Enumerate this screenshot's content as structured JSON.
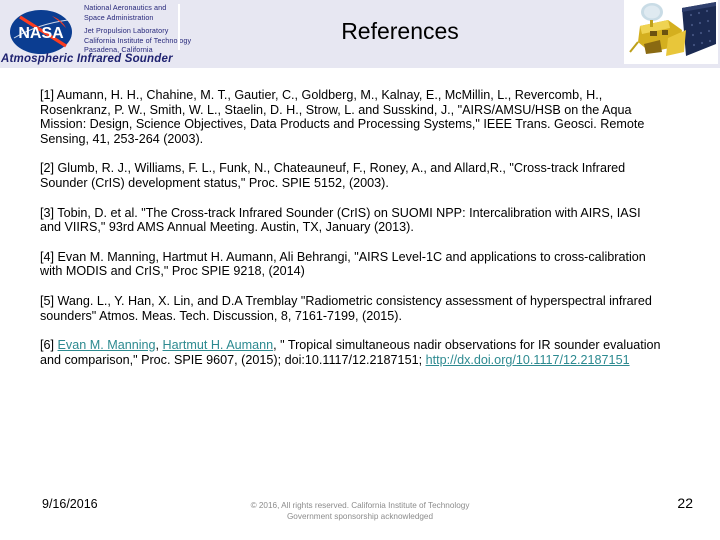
{
  "header": {
    "agency_lines": [
      "National Aeronautics and",
      "Space Administration",
      "Jet Propulsion Laboratory",
      "California Institute of Technology",
      "Pasadena, California"
    ],
    "logo_text": "NASA",
    "program_banner": "Atmospheric  Infrared Sounder",
    "title": "References",
    "satellite_alt": "aqua-satellite-illustration"
  },
  "references": [
    {
      "id": "ref-1",
      "segments": [
        {
          "type": "text",
          "value": "[1] Aumann, H. H., Chahine, M. T., Gautier, C., Goldberg, M., Kalnay, E., McMillin, L., Revercomb, H., Rosenkranz, P. W., Smith, W. L., Staelin, D. H., Strow, L. and Susskind, J., \"AIRS/AMSU/HSB on the Aqua Mission: Design, Science Objectives, Data Products and Processing Systems,\" IEEE Trans. Geosci. Remote Sensing, 41, 253-264 (2003)."
        }
      ]
    },
    {
      "id": "ref-2",
      "segments": [
        {
          "type": "text",
          "value": "[2] Glumb, R. J., Williams, F. L., Funk, N., Chateauneuf, F., Roney, A., and Allard,R., \"Cross-track Infrared Sounder (CrIS) development status,\" Proc. SPIE 5152, (2003)."
        }
      ]
    },
    {
      "id": "ref-3",
      "segments": [
        {
          "type": "text",
          "value": "[3] Tobin, D. et al. \"The Cross-track Infrared Sounder (CrIS) on SUOMI NPP: Intercalibration with AIRS, IASI and VIIRS,\" 93rd AMS Annual Meeting. Austin, TX, January (2013)."
        }
      ]
    },
    {
      "id": "ref-4",
      "segments": [
        {
          "type": "text",
          "value": "[4] Evan M. Manning, Hartmut H. Aumann, Ali Behrangi, \"AIRS Level-1C and applications to cross-calibration with MODIS and CrIS,\" Proc SPIE 9218, (2014)"
        }
      ]
    },
    {
      "id": "ref-5",
      "segments": [
        {
          "type": "text",
          "value": "[5] Wang. L., Y. Han, X. Lin, and D.A Tremblay \"Radiometric consistency assessment of hyperspectral infrared sounders\" Atmos. Meas. Tech. Discussion, 8, 7161-7199, (2015)."
        }
      ]
    },
    {
      "id": "ref-6",
      "segments": [
        {
          "type": "text",
          "value": "[6] "
        },
        {
          "type": "link",
          "value": "Evan M. Manning"
        },
        {
          "type": "text",
          "value": ", "
        },
        {
          "type": "link",
          "value": "Hartmut H. Aumann"
        },
        {
          "type": "text",
          "value": ", \" Tropical simultaneous nadir observations for IR sounder evaluation and comparison,\" Proc. SPIE 9607,  (2015); doi:10.1117/12.2187151; "
        },
        {
          "type": "link",
          "value": "http://dx.doi.org/10.1117/12.2187151"
        }
      ]
    }
  ],
  "footer": {
    "date": "9/16/2016",
    "copyright_line_1": "© 2016, All rights reserved. California Institute of Technology",
    "copyright_line_2": "Government sponsorship acknowledged",
    "page_number": "22"
  },
  "colors": {
    "header_band": "#e7e7f2",
    "nasa_blue": "#26277a",
    "banner_navy": "#1f2270",
    "link_teal": "#2d8a90",
    "footer_gray": "#8c8c8c"
  }
}
